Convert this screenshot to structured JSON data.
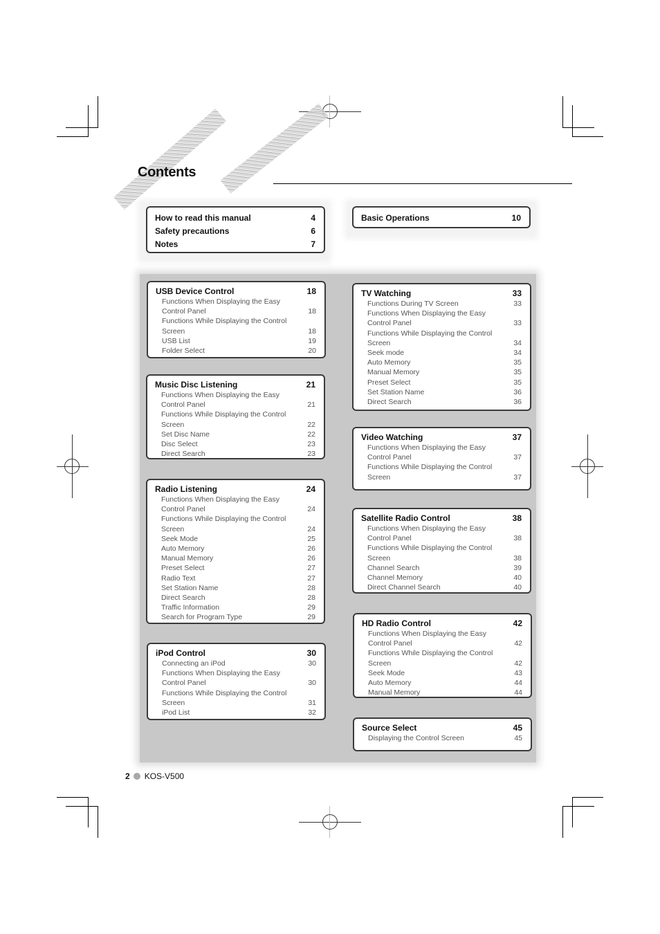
{
  "page": {
    "title": "Contents",
    "footer": {
      "page_number": "2",
      "model": "KOS-V500"
    }
  },
  "top_left_box": {
    "entries": [
      {
        "label": "How to read this manual",
        "page": "4"
      },
      {
        "label": "Safety precautions",
        "page": "6"
      },
      {
        "label": "Notes",
        "page": "7"
      }
    ]
  },
  "top_right_box": {
    "entries": [
      {
        "label": "Basic Operations",
        "page": "10"
      }
    ]
  },
  "sections": {
    "usb": {
      "title": "USB Device Control",
      "page": "18",
      "items": [
        {
          "label": "Functions When Displaying the Easy\n   Control Panel",
          "page": "18"
        },
        {
          "label": "Functions While Displaying the Control\n   Screen",
          "page": "18"
        },
        {
          "label": "USB List",
          "page": "19"
        },
        {
          "label": "Folder Select",
          "page": "20"
        }
      ]
    },
    "disc": {
      "title": "Music Disc Listening",
      "page": "21",
      "items": [
        {
          "label": "Functions When Displaying the Easy\n   Control Panel",
          "page": "21"
        },
        {
          "label": "Functions While Displaying the Control\n   Screen",
          "page": "22"
        },
        {
          "label": "Set Disc Name",
          "page": "22"
        },
        {
          "label": "Disc Select",
          "page": "23"
        },
        {
          "label": "Direct Search",
          "page": "23"
        }
      ]
    },
    "radio": {
      "title": "Radio Listening",
      "page": "24",
      "items": [
        {
          "label": "Functions When Displaying the Easy\n   Control Panel",
          "page": "24"
        },
        {
          "label": "Functions While Displaying the Control\n   Screen",
          "page": "24"
        },
        {
          "label": "Seek Mode",
          "page": "25"
        },
        {
          "label": "Auto Memory",
          "page": "26"
        },
        {
          "label": "Manual Memory",
          "page": "26"
        },
        {
          "label": "Preset Select",
          "page": "27"
        },
        {
          "label": "Radio Text",
          "page": "27"
        },
        {
          "label": "Set Station Name",
          "page": "28"
        },
        {
          "label": "Direct Search",
          "page": "28"
        },
        {
          "label": "Traffic Information",
          "page": "29"
        },
        {
          "label": "Search for Program Type",
          "page": "29"
        }
      ]
    },
    "ipod": {
      "title": "iPod Control",
      "page": "30",
      "items": [
        {
          "label": "Connecting an iPod",
          "page": "30"
        },
        {
          "label": "Functions When Displaying the Easy\n   Control Panel",
          "page": "30"
        },
        {
          "label": "Functions While Displaying the Control\n   Screen",
          "page": "31"
        },
        {
          "label": "iPod List",
          "page": "32"
        }
      ]
    },
    "tv": {
      "title": "TV Watching",
      "page": "33",
      "items": [
        {
          "label": "Functions During TV Screen",
          "page": "33"
        },
        {
          "label": "Functions When Displaying the Easy\n   Control Panel",
          "page": "33"
        },
        {
          "label": "Functions While Displaying the Control\n   Screen",
          "page": "34"
        },
        {
          "label": "Seek mode",
          "page": "34"
        },
        {
          "label": "Auto Memory",
          "page": "35"
        },
        {
          "label": "Manual Memory",
          "page": "35"
        },
        {
          "label": "Preset Select",
          "page": "35"
        },
        {
          "label": "Set Station Name",
          "page": "36"
        },
        {
          "label": "Direct Search",
          "page": "36"
        }
      ]
    },
    "video": {
      "title": "Video Watching",
      "page": "37",
      "items": [
        {
          "label": "Functions When Displaying the Easy\n   Control Panel",
          "page": "37"
        },
        {
          "label": "Functions While Displaying the Control\n   Screen",
          "page": "37"
        }
      ]
    },
    "satellite": {
      "title": "Satellite Radio Control",
      "page": "38",
      "items": [
        {
          "label": "Functions When Displaying the Easy\n   Control Panel",
          "page": "38"
        },
        {
          "label": "Functions While Displaying the Control\n   Screen",
          "page": "38"
        },
        {
          "label": "Channel Search",
          "page": "39"
        },
        {
          "label": "Channel Memory",
          "page": "40"
        },
        {
          "label": "Direct Channel Search",
          "page": "40"
        }
      ]
    },
    "hd": {
      "title": "HD Radio Control",
      "page": "42",
      "items": [
        {
          "label": "Functions When Displaying the Easy\n   Control Panel",
          "page": "42"
        },
        {
          "label": "Functions While Displaying the Control\n   Screen",
          "page": "42"
        },
        {
          "label": "Seek Mode",
          "page": "43"
        },
        {
          "label": "Auto Memory",
          "page": "44"
        },
        {
          "label": "Manual Memory",
          "page": "44"
        }
      ]
    },
    "source": {
      "title": "Source Select",
      "page": "45",
      "items": [
        {
          "label": "Displaying the Control Screen",
          "page": "45"
        }
      ]
    }
  }
}
